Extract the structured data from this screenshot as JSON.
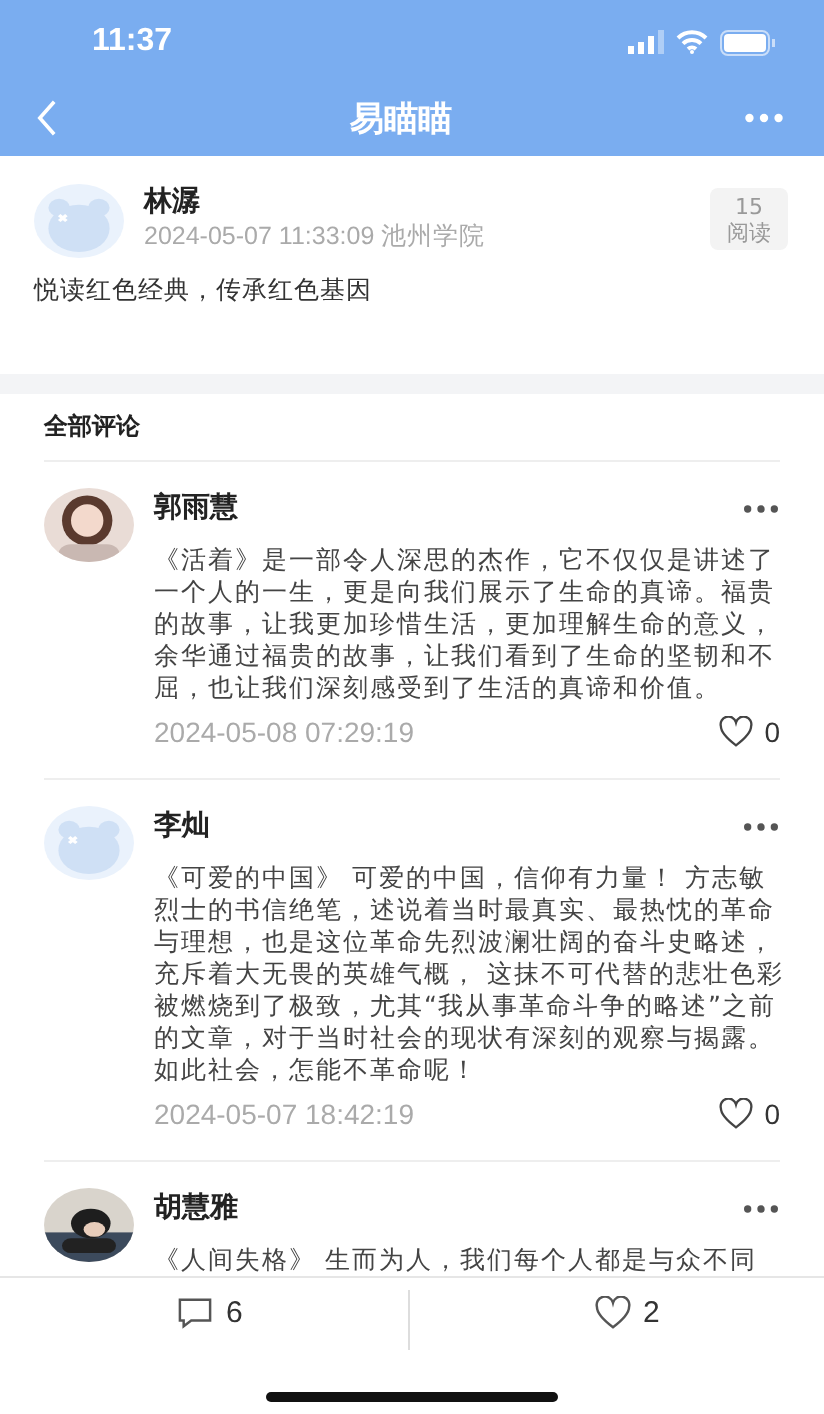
{
  "status_bar": {
    "time": "11:37"
  },
  "nav": {
    "title": "易瞄瞄"
  },
  "post": {
    "author": "林潺",
    "avatar": {
      "kind": "default"
    },
    "meta": "2024-05-07 11:33:09 池州学院",
    "read_count": "15",
    "read_label": "阅读",
    "body": "悦读红色经典，传承红色基因"
  },
  "comments_heading": "全部评论",
  "comments": [
    {
      "name": "郭雨慧",
      "text": "《活着》是一部令人深思的杰作，它不仅仅是讲述了一个人的一生，更是向我们展示了生命的真谛。福贵的故事，让我更加珍惜生活，更加理解生命的意义，余华通过福贵的故事，让我们看到了生命的坚韧和不屈，也让我们深刻感受到了生活的真谛和价值。",
      "time": "2024-05-08 07:29:19",
      "likes": "0"
    },
    {
      "name": "李灿",
      "avatar": {
        "kind": "default"
      },
      "text": "《可爱的中国》 可爱的中国，信仰有力量！ 方志敏烈士的书信绝笔，述说着当时最真实、最热忱的革命与理想，也是这位革命先烈波澜壮阔的奋斗史略述，充斥着大无畏的英雄气概， 这抹不可代替的悲壮色彩被燃烧到了极致，尤其“我从事革命斗争的略述”之前的文章，对于当时社会的现状有深刻的观察与揭露。如此社会，怎能不革命呢！",
      "time": "2024-05-07 18:42:19",
      "likes": "0"
    },
    {
      "name": "胡慧雅",
      "text": "《人间失格》 生而为人，我们每个人都是与众不同"
    }
  ],
  "bottom_bar": {
    "comment_count": "6",
    "like_count": "2"
  }
}
